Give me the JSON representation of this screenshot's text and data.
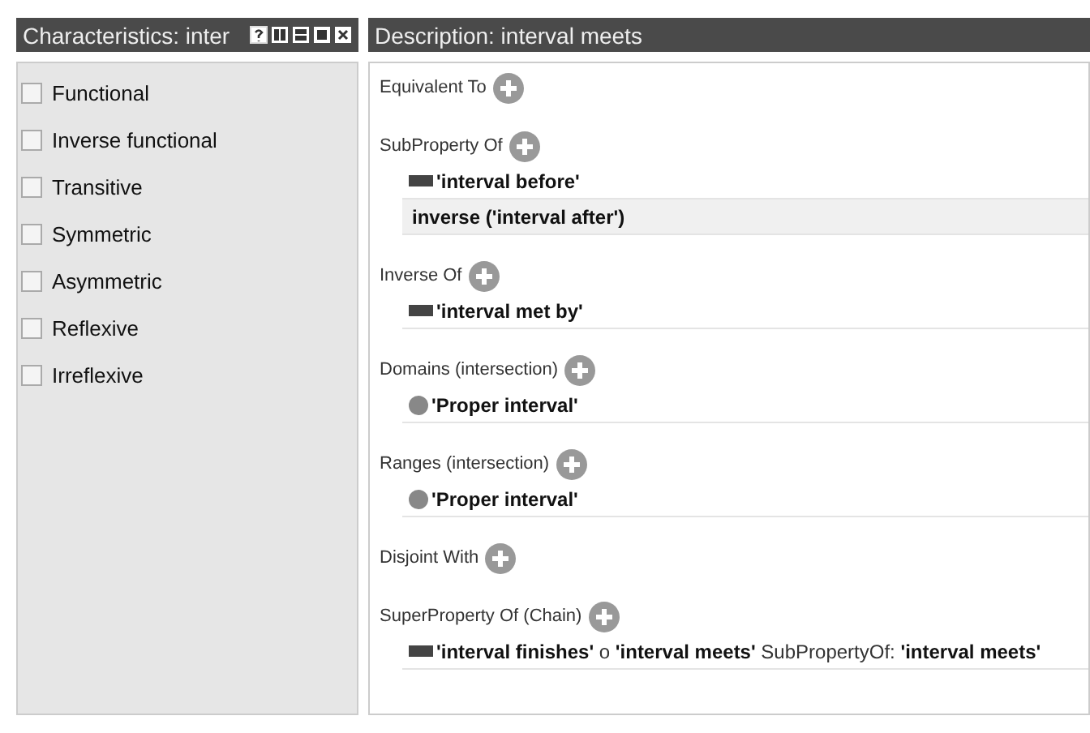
{
  "characteristics_panel": {
    "title": "Characteristics: inter",
    "items": [
      {
        "label": "Functional",
        "checked": false
      },
      {
        "label": "Inverse functional",
        "checked": false
      },
      {
        "label": "Transitive",
        "checked": false
      },
      {
        "label": "Symmetric",
        "checked": false
      },
      {
        "label": "Asymmetric",
        "checked": false
      },
      {
        "label": "Reflexive",
        "checked": false
      },
      {
        "label": "Irreflexive",
        "checked": false
      }
    ]
  },
  "description_panel": {
    "title": "Description: interval meets",
    "sections": [
      {
        "label": "Equivalent To"
      },
      {
        "label": "SubProperty Of",
        "entries": [
          {
            "kind": "property",
            "text": "'interval before'",
            "selected": false
          },
          {
            "kind": "expression",
            "text": "inverse ('interval after')",
            "selected": true
          }
        ]
      },
      {
        "label": "Inverse Of",
        "entries": [
          {
            "kind": "property",
            "text": "'interval met by'",
            "selected": false
          }
        ]
      },
      {
        "label": "Domains (intersection)",
        "entries": [
          {
            "kind": "class",
            "text": "'Proper interval'",
            "selected": false
          }
        ]
      },
      {
        "label": "Ranges (intersection)",
        "entries": [
          {
            "kind": "class",
            "text": "'Proper interval'",
            "selected": false
          }
        ]
      },
      {
        "label": "Disjoint With"
      },
      {
        "label": "SuperProperty Of (Chain)",
        "entries": [
          {
            "kind": "chain",
            "text": "**'interval finishes'** o **'interval meets'** SubPropertyOf: **'interval meets'**",
            "selected": false
          }
        ]
      }
    ]
  }
}
